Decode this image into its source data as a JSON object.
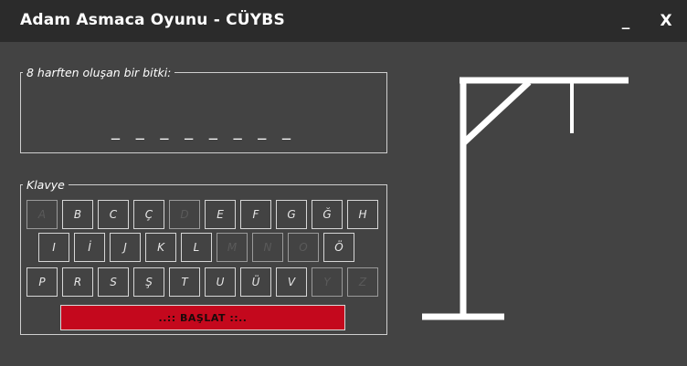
{
  "window": {
    "title": "Adam Asmaca Oyunu - CÜYBS",
    "minimize_label": "_",
    "close_label": "X"
  },
  "word_panel": {
    "legend": "8 harften oluşan bir bitki:",
    "masked_word": "_ _ _ _ _ _ _ _"
  },
  "keyboard": {
    "legend": "Klavye",
    "rows": [
      [
        {
          "label": "A",
          "enabled": false
        },
        {
          "label": "B",
          "enabled": true
        },
        {
          "label": "C",
          "enabled": true
        },
        {
          "label": "Ç",
          "enabled": true
        },
        {
          "label": "D",
          "enabled": false
        },
        {
          "label": "E",
          "enabled": true
        },
        {
          "label": "F",
          "enabled": true
        },
        {
          "label": "G",
          "enabled": true
        },
        {
          "label": "Ğ",
          "enabled": true
        },
        {
          "label": "H",
          "enabled": true
        }
      ],
      [
        {
          "label": "I",
          "enabled": true
        },
        {
          "label": "İ",
          "enabled": true
        },
        {
          "label": "J",
          "enabled": true
        },
        {
          "label": "K",
          "enabled": true
        },
        {
          "label": "L",
          "enabled": true
        },
        {
          "label": "M",
          "enabled": false
        },
        {
          "label": "N",
          "enabled": false
        },
        {
          "label": "O",
          "enabled": false
        },
        {
          "label": "Ö",
          "enabled": true
        }
      ],
      [
        {
          "label": "P",
          "enabled": true
        },
        {
          "label": "R",
          "enabled": true
        },
        {
          "label": "S",
          "enabled": true
        },
        {
          "label": "Ş",
          "enabled": true
        },
        {
          "label": "T",
          "enabled": true
        },
        {
          "label": "U",
          "enabled": true
        },
        {
          "label": "Ü",
          "enabled": true
        },
        {
          "label": "V",
          "enabled": true
        },
        {
          "label": "Y",
          "enabled": false
        },
        {
          "label": "Z",
          "enabled": false
        }
      ]
    ],
    "start_label": "..::  BAŞLAT  ::.."
  },
  "colors": {
    "background": "#434343",
    "titlebar": "#2b2b2b",
    "start_button": "#c4081d",
    "gallows": "#ffffff"
  },
  "icons": {
    "gallows": "hangman-gallows-icon"
  }
}
